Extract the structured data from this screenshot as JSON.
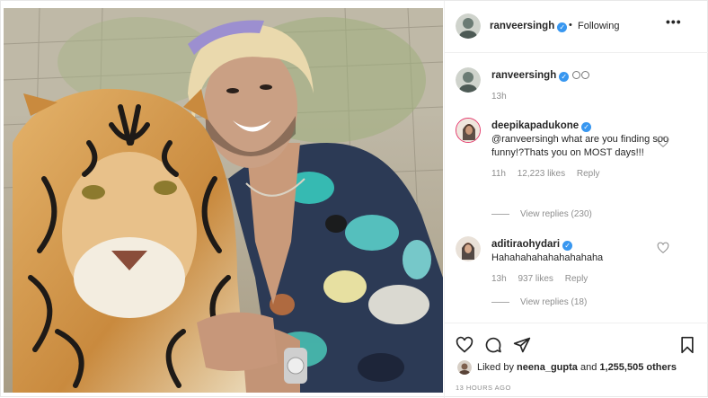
{
  "post": {
    "photo_alt": "photo-of-man-with-tiger",
    "author": "ranveersingh",
    "follow_status": "Following",
    "more_label": "•••",
    "separator": "•"
  },
  "caption": {
    "username": "ranveersingh",
    "emoji_count": 2,
    "age": "13h"
  },
  "comments": [
    {
      "username": "deepikapadukone",
      "text": "@ranveersingh what are you finding soo funny!?Thats you on MOST days!!!",
      "age": "11h",
      "likes": "12,223 likes",
      "reply_label": "Reply",
      "view_replies": "View replies (230)"
    },
    {
      "username": "aditiraohydari",
      "text": "Hahahahahahahahahaha",
      "age": "13h",
      "likes": "937 likes",
      "reply_label": "Reply",
      "view_replies": "View replies (18)"
    }
  ],
  "likes_bar": {
    "prefix": "Liked by",
    "liker": "neena_gupta",
    "connector": "and",
    "count": "1,255,505 others"
  },
  "timestamp": "13 HOURS AGO",
  "colors": {
    "verified": "#3897f0",
    "meta_gray": "#8e8e8e",
    "text": "#262626"
  },
  "icons": [
    "heart-icon",
    "comment-icon",
    "share-icon",
    "bookmark-icon",
    "more-options-icon",
    "verified-badge-icon"
  ]
}
